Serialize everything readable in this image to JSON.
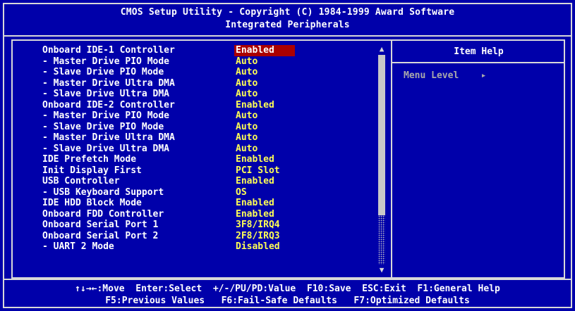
{
  "header": {
    "line1": "CMOS Setup Utility - Copyright (C) 1984-1999 Award Software",
    "line2": "Integrated Peripherals"
  },
  "items": [
    {
      "label": "Onboard IDE-1 Controller",
      "value": "Enabled",
      "selected": true
    },
    {
      "label": "- Master Drive PIO Mode",
      "value": "Auto"
    },
    {
      "label": "- Slave Drive PIO Mode",
      "value": "Auto"
    },
    {
      "label": "- Master Drive Ultra DMA",
      "value": "Auto"
    },
    {
      "label": "- Slave Drive Ultra DMA",
      "value": "Auto"
    },
    {
      "label": "Onboard IDE-2 Controller",
      "value": "Enabled"
    },
    {
      "label": "- Master Drive PIO Mode",
      "value": "Auto"
    },
    {
      "label": "- Slave Drive PIO Mode",
      "value": "Auto"
    },
    {
      "label": "- Master Drive Ultra DMA",
      "value": "Auto"
    },
    {
      "label": "- Slave Drive Ultra DMA",
      "value": "Auto"
    },
    {
      "label": "IDE Prefetch Mode",
      "value": "Enabled"
    },
    {
      "label": "Init Display First",
      "value": "PCI Slot"
    },
    {
      "label": "USB Controller",
      "value": "Enabled"
    },
    {
      "label": "- USB Keyboard Support",
      "value": "OS"
    },
    {
      "label": "IDE HDD Block Mode",
      "value": "Enabled"
    },
    {
      "label": "Onboard FDD Controller",
      "value": "Enabled"
    },
    {
      "label": "Onboard Serial Port 1",
      "value": "3F8/IRQ4"
    },
    {
      "label": "Onboard Serial Port 2",
      "value": "2F8/IRQ3"
    },
    {
      "label": "- UART 2 Mode",
      "value": "Disabled"
    }
  ],
  "scrollbar": {
    "up_arrow": "▲",
    "down_arrow": "▼"
  },
  "help": {
    "title": "Item Help",
    "menu_level_label": "Menu Level",
    "menu_level_arrow": "▸"
  },
  "footer": {
    "line1": "↑↓→←:Move  Enter:Select  +/-/PU/PD:Value  F10:Save  ESC:Exit  F1:General Help",
    "line2": "F5:Previous Values   F6:Fail-Safe Defaults   F7:Optimized Defaults"
  },
  "colors": {
    "background": "#0000aa",
    "value": "#ffff55",
    "label": "#ffffff",
    "selection": "#aa0000",
    "border": "#d8d8d8"
  }
}
